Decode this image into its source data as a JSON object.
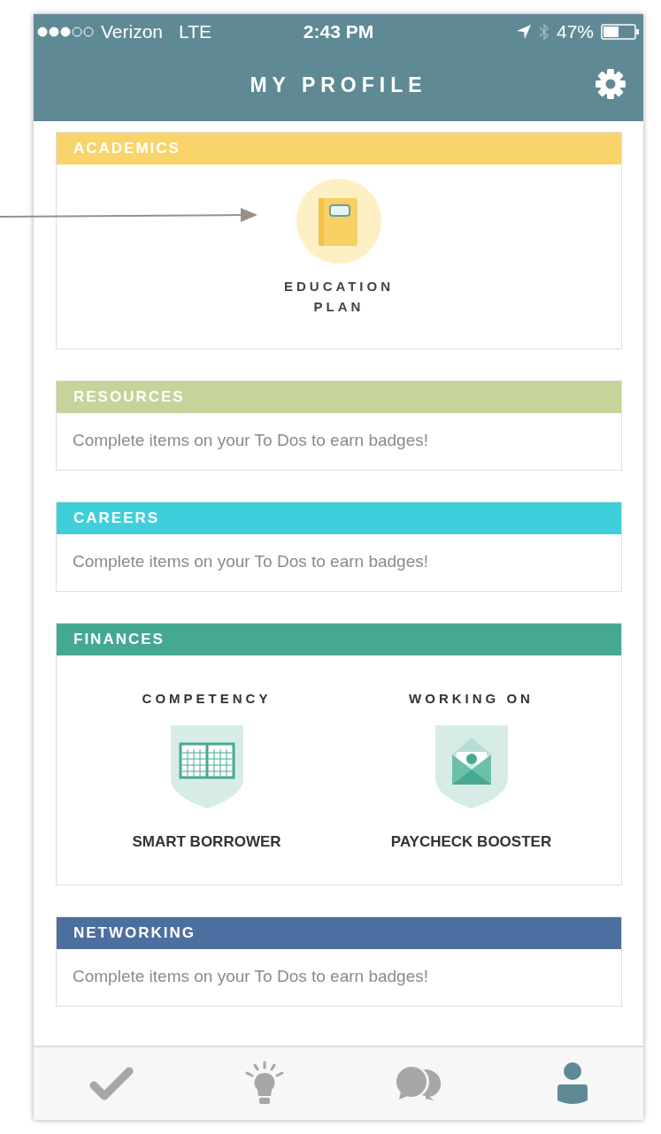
{
  "status_bar": {
    "carrier": "Verizon",
    "network": "LTE",
    "time": "2:43 PM",
    "battery": "47%"
  },
  "header": {
    "title": "MY PROFILE"
  },
  "sections": [
    {
      "title": "ACADEMICS",
      "color": "#f9d46b",
      "kind": "badges",
      "badges": [
        {
          "kind": "notebook",
          "name": "EDUCATION PLAN"
        }
      ]
    },
    {
      "title": "RESOURCES",
      "color": "#c6d39a",
      "kind": "empty",
      "message": "Complete items on your To Dos to earn badges!"
    },
    {
      "title": "CAREERS",
      "color": "#3fcfdb",
      "kind": "empty",
      "message": "Complete items on your To Dos to earn badges!"
    },
    {
      "title": "FINANCES",
      "color": "#45a991",
      "kind": "columns",
      "columns": [
        {
          "heading": "COMPETENCY",
          "kind": "calendar",
          "name": "SMART BORROWER"
        },
        {
          "heading": "WORKING ON",
          "kind": "envelope",
          "name": "PAYCHECK BOOSTER"
        }
      ]
    },
    {
      "title": "NETWORKING",
      "color": "#4d6fa0",
      "kind": "empty",
      "message": "Complete items on your To Dos to earn badges!"
    }
  ],
  "tab_bar": {
    "items": [
      {
        "kind": "check",
        "selected": false
      },
      {
        "kind": "bulb",
        "selected": false
      },
      {
        "kind": "chat",
        "selected": false
      },
      {
        "kind": "person",
        "selected": true
      }
    ]
  }
}
